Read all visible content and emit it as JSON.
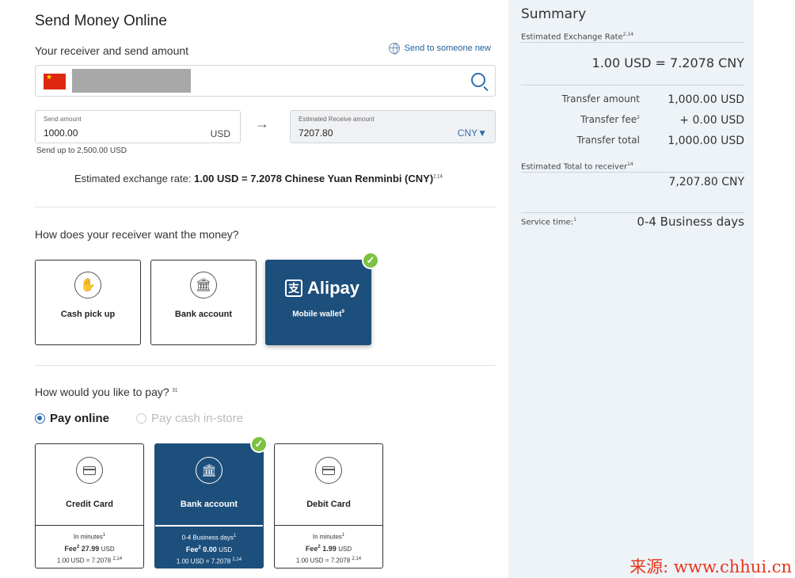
{
  "page_title": "Send Money Online",
  "receiver_section": {
    "title": "Your receiver and send amount",
    "send_new_label": "Send to someone new"
  },
  "send_amount": {
    "label": "Send amount",
    "value": "1000.00",
    "currency": "USD",
    "limit_note": "Send up to 2,500.00 USD"
  },
  "receive_amount": {
    "label": "Estimated Receive amount",
    "value": "7207.80",
    "currency": "CNY▼"
  },
  "exchange_line": {
    "prefix": "Estimated exchange rate: ",
    "rate": "1.00 USD = 7.2078 Chinese Yuan Renminbi (CNY)",
    "sup": "2,14"
  },
  "receive_method": {
    "question": "How does your receiver want the money?",
    "options": [
      {
        "label": "Cash pick up",
        "icon": "cash-hand-icon"
      },
      {
        "label": "Bank account",
        "icon": "bank-icon"
      },
      {
        "label": "Mobile wallet",
        "sup": "9",
        "brand": "Alipay",
        "brand_mark": "支",
        "icon": "alipay-logo"
      }
    ]
  },
  "payment": {
    "question": "How would you like to pay?",
    "question_sup": "31",
    "radio_online": "Pay online",
    "radio_cash": "Pay cash in-store",
    "cards": [
      {
        "label": "Credit Card",
        "time": "In minutes",
        "time_sup": "1",
        "fee_label": "Fee",
        "fee_sup": "2",
        "fee": "27.99",
        "fee_currency": "USD",
        "rate": "1.00 USD = 7.2078",
        "rate_sup": "2,14"
      },
      {
        "label": "Bank account",
        "time": "0-4 Business days",
        "time_sup": "1",
        "fee_label": "Fee",
        "fee_sup": "2",
        "fee": "0.00",
        "fee_currency": "USD",
        "rate": "1.00 USD = 7.2078",
        "rate_sup": "2,14"
      },
      {
        "label": "Debit Card",
        "time": "In minutes",
        "time_sup": "1",
        "fee_label": "Fee",
        "fee_sup": "2",
        "fee": "1.99",
        "fee_currency": "USD",
        "rate": "1.00 USD = 7.2078",
        "rate_sup": "2,14"
      }
    ]
  },
  "summary": {
    "title": "Summary",
    "rate_label": "Estimated Exchange Rate",
    "rate_label_sup": "2,14",
    "rate_value": "1.00 USD = 7.2078 CNY",
    "rows": [
      {
        "label": "Transfer amount",
        "sup": "",
        "value": "1,000.00 USD"
      },
      {
        "label": "Transfer fee",
        "sup": "2",
        "value": "+ 0.00 USD"
      },
      {
        "label": "Transfer total",
        "sup": "",
        "value": "1,000.00 USD"
      }
    ],
    "total_label": "Estimated Total  to receiver",
    "total_label_sup": "14",
    "total_value": "7,207.80 CNY",
    "service_label": "Service time:",
    "service_sup": "1",
    "service_value": "0-4 Business days"
  },
  "watermark": "来源: www.chhui.cn",
  "colors": {
    "accent": "#1d4f7c",
    "check": "#7cc243",
    "link": "#2c6fb0",
    "watermark": "#e8361a"
  }
}
